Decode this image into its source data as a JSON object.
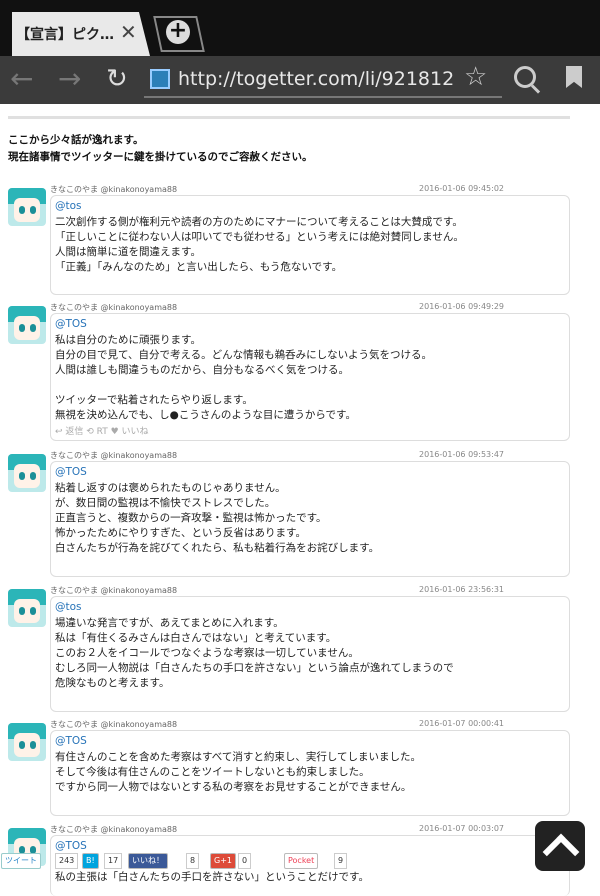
{
  "tab": {
    "title": "【宣言】ピク…",
    "close": "✕"
  },
  "newtab_symbol": "+",
  "toolbar": {
    "url": "http://togetter.com/li/921812",
    "back": "←",
    "forward": "→",
    "reload": "↻",
    "star": "☆"
  },
  "intro": [
    "ここから少々話が逸れます。",
    "現在諸事情でツイッターに鍵を掛けているのでご容赦ください。"
  ],
  "tweets": [
    {
      "user": "きなこのやま @kinakonoyama88",
      "time": "2016-01-06 09:45:02",
      "mention": "@tos",
      "body": "二次創作する側が権利元や読者の方のためにマナーについて考えることは大賛成です。\n「正しいことに従わない人は叩いてでも従わせる」という考えには絶対賛同しません。\n人間は簡単に道を間違えます。\n「正義」「みんなのため」と言い出したら、もう危ないです。"
    },
    {
      "user": "きなこのやま @kinakonoyama88",
      "time": "2016-01-06 09:49:29",
      "mention": "@TOS",
      "body": "私は自分のために頑張ります。\n自分の目で見て、自分で考える。どんな情報も鵜呑みにしないよう気をつける。\n人間は誰しも間違うものだから、自分もなるべく気をつける。\n\nツイッターで粘着されたらやり返します。\n無視を決め込んでも、し●こうさんのような目に遭うからです。",
      "actions": "↩ 返信  ⟲ RT  ♥ いいね"
    },
    {
      "user": "きなこのやま @kinakonoyama88",
      "time": "2016-01-06 09:53:47",
      "mention": "@TOS",
      "body": "粘着し返すのは褒められたものじゃありません。\nが、数日間の監視は不愉快でストレスでした。\n正直言うと、複数からの一斉攻撃・監視は怖かったです。\n怖かったためにやりすぎた、という反省はあります。\n白さんたちが行為を詫びてくれたら、私も粘着行為をお詫びします。"
    },
    {
      "user": "きなこのやま @kinakonoyama88",
      "time": "2016-01-06 23:56:31",
      "mention": "@tos",
      "body": "場違いな発言ですが、あえてまとめに入れます。\n私は「有住くるみさんは白さんではない」と考えています。\nこのお２人をイコールでつなぐような考察は一切していません。\nむしろ同一人物説は「白さんたちの手口を許さない」という論点が逸れてしまうので\n危険なものと考えます。"
    },
    {
      "user": "きなこのやま @kinakonoyama88",
      "time": "2016-01-07 00:00:41",
      "mention": "@TOS",
      "body": "有住さんのことを含めた考察はすべて消すと約束し、実行してしまいました。\nそして今後は有住さんのことをツイートしないとも約束しました。\nですから同一人物ではないとする私の考察をお見せすることができません。"
    },
    {
      "user": "きなこのやま @kinakonoyama88",
      "time": "2016-01-07 00:03:07",
      "mention": "@TOS",
      "body": "　\n私の主張は「白さんたちの手口を許さない」ということだけです。"
    }
  ],
  "sharebar": {
    "tweet_label": "ツイート",
    "tweet_count": "243",
    "hatena_label": "B!",
    "hatena_count": "17",
    "fb_label": "いいね！",
    "fb_count": "8",
    "gplus_label": "G+1",
    "gplus_count": "0",
    "pocket_label": "Pocket",
    "pocket_count": "9"
  },
  "colors": {
    "tabbar": "#111111",
    "toolbar": "#3b3b3b",
    "link": "#2773b8",
    "twitter": "#55acee",
    "facebook": "#3b5998",
    "gplus": "#dd4b39",
    "pocket": "#ee4056",
    "hatena": "#00a4de"
  }
}
